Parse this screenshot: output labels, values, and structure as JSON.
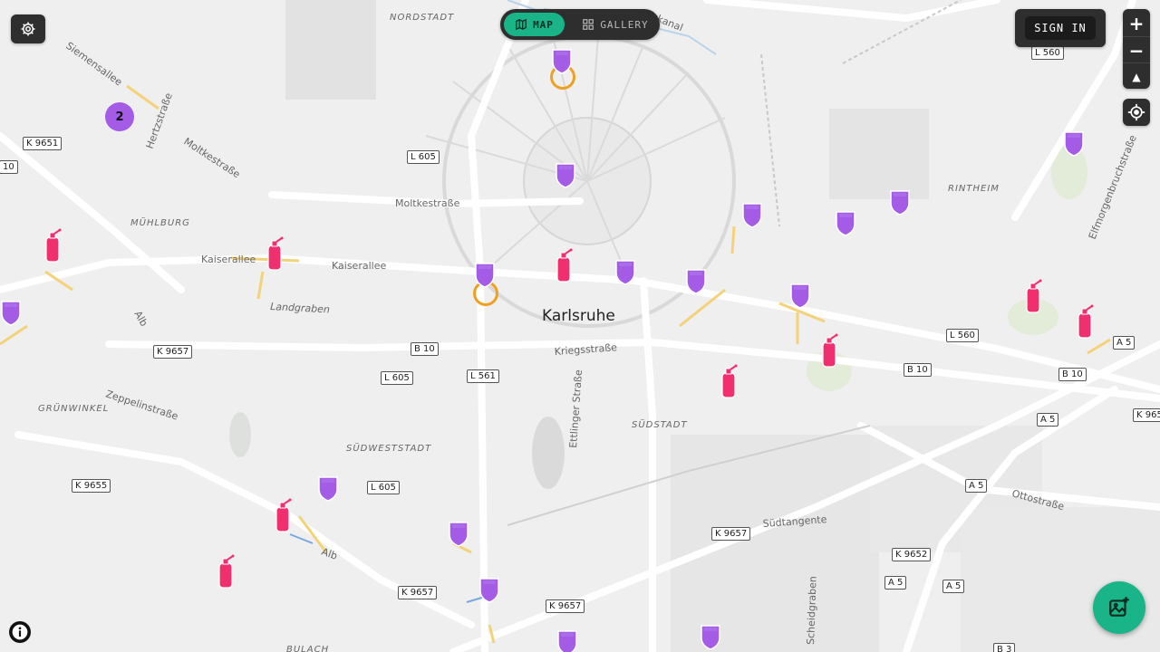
{
  "controls": {
    "map_label": "MAP",
    "gallery_label": "GALLERY",
    "signin_label": "SIGN IN",
    "zoom_in": "+",
    "zoom_out": "−",
    "compass": "▲"
  },
  "map": {
    "city": "Karlsruhe",
    "districts": [
      "NORDSTADT",
      "RINTHEIM",
      "MÜHLBURG",
      "GRÜNWINKEL",
      "SÜDWESTSTADT",
      "SÜDSTADT",
      "BULACH"
    ],
    "streets": [
      "Moltkestraße",
      "Kaiserallee",
      "Landgraben",
      "Kriegsstraße",
      "Zeppelinstraße",
      "Ettlinger Straße",
      "Südtangente",
      "Ottostraße",
      "Siemensallee",
      "Hertzstraße",
      "Elfmorgenbruchstraße",
      "Scheidgraben",
      "Alb",
      "ngskanal"
    ],
    "road_refs": [
      "K 9651",
      "10",
      "L 605",
      "L 560",
      "K 9657",
      "B 10",
      "L 561",
      "L 605",
      "B 10",
      "L 560",
      "A 5",
      "B 10",
      "A 5",
      "K 965",
      "K 9655",
      "L 605",
      "A 5",
      "K 9657",
      "K 9652",
      "A 5",
      "A 5",
      "K 9657",
      "K 9657",
      "B 3"
    ],
    "cluster_count": "2"
  },
  "colors": {
    "marker_purple": "#a45be6",
    "marker_pink": "#f0306e",
    "accent_green": "#19b488",
    "ring_orange": "#f0a020",
    "control_dark": "#2e2e2e"
  },
  "icons": [
    "settings-gear-icon",
    "map-icon",
    "gallery-grid-icon",
    "locate-crosshair-icon",
    "info-icon",
    "add-photo-icon"
  ]
}
